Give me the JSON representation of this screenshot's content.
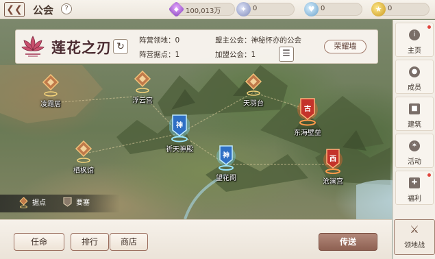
{
  "header": {
    "back_icon": "back-arrow-icon",
    "title": "公会",
    "help_label": "?",
    "resources": [
      {
        "icon": "gem-icon",
        "value": "100,013万"
      },
      {
        "icon": "medal-icon",
        "value": "0"
      },
      {
        "icon": "heart-coin-icon",
        "value": "0"
      },
      {
        "icon": "gold-coin-icon",
        "value": "0"
      }
    ]
  },
  "guild": {
    "name": "莲花之刃",
    "emblem_icon": "lotus-emblem-icon",
    "territory_label": "阵营领地：0",
    "stronghold_label": "阵营据点：1",
    "leader_guild_label": "盟主公会：神秘怀亦的公会",
    "joined_guilds_label": "加盟公会：1",
    "honor_wall_button": "荣耀墙"
  },
  "map": {
    "markers": [
      {
        "label": "凌霜居",
        "type": "stronghold",
        "glyph": ""
      },
      {
        "label": "浮云宫",
        "type": "stronghold",
        "glyph": ""
      },
      {
        "label": "天羽台",
        "type": "stronghold",
        "glyph": ""
      },
      {
        "label": "东海壁垒",
        "type": "enemy-fortress",
        "glyph": "古"
      },
      {
        "label": "祈天神殿",
        "type": "divine-fortress",
        "glyph": "神"
      },
      {
        "label": "栖枫馆",
        "type": "stronghold",
        "glyph": ""
      },
      {
        "label": "望花阁",
        "type": "divine-fortress",
        "glyph": "神"
      },
      {
        "label": "沧澜宫",
        "type": "enemy-fortress",
        "glyph": "西"
      }
    ],
    "legend": {
      "stronghold": "据点",
      "fortress": "要塞"
    }
  },
  "actions": {
    "appoint": "任命",
    "rank": "排行",
    "shop": "商店",
    "teleport": "传送"
  },
  "sidebar": {
    "items": [
      {
        "label": "主页",
        "icon": "info-icon",
        "badge": true
      },
      {
        "label": "成员",
        "icon": "members-icon",
        "badge": false
      },
      {
        "label": "建筑",
        "icon": "building-icon",
        "badge": false
      },
      {
        "label": "活动",
        "icon": "activity-icon",
        "badge": false
      },
      {
        "label": "福利",
        "icon": "gift-icon",
        "badge": true
      },
      {
        "label": "领地战",
        "icon": "crossed-swords-icon",
        "badge": false
      }
    ]
  }
}
